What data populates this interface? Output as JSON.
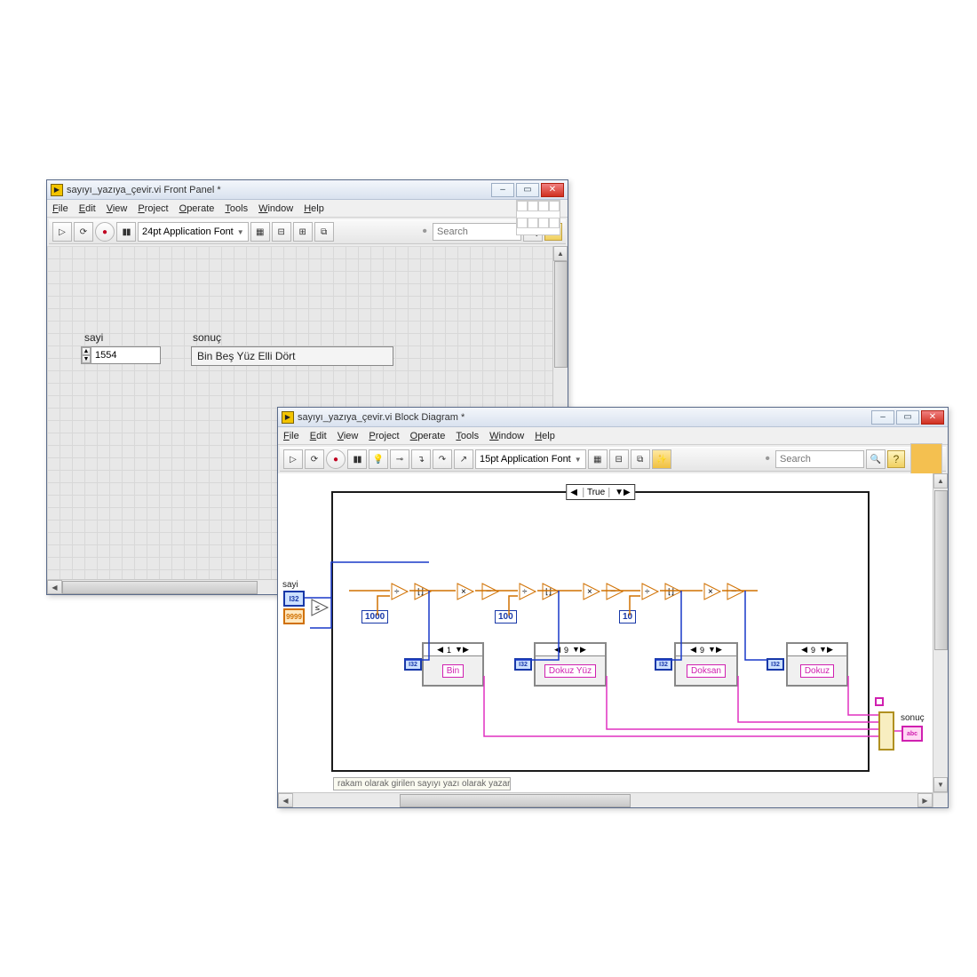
{
  "front_panel": {
    "title": "sayıyı_yazıya_çevir.vi Front Panel *",
    "menu": [
      "File",
      "Edit",
      "View",
      "Project",
      "Operate",
      "Tools",
      "Window",
      "Help"
    ],
    "font_selector": "24pt Application Font",
    "search_placeholder": "Search",
    "controls": {
      "sayi": {
        "label": "sayi",
        "value": "1554"
      },
      "sonuc": {
        "label": "sonuç",
        "value": "Bin Beş Yüz Elli Dört"
      }
    }
  },
  "block_diagram": {
    "title": "sayıyı_yazıya_çevir.vi Block Diagram *",
    "menu": [
      "File",
      "Edit",
      "View",
      "Project",
      "Operate",
      "Tools",
      "Window",
      "Help"
    ],
    "font_selector": "15pt Application Font",
    "search_placeholder": "Search",
    "case_selector": "True",
    "terminals": {
      "sayi": "sayi",
      "const9999": "9999",
      "sonuc": "sonuç"
    },
    "constants": {
      "c1000": "1000",
      "c100": "100",
      "c10": "10"
    },
    "case_boxes": [
      {
        "index": "1",
        "string": "Bin"
      },
      {
        "index": "9",
        "string": "Dokuz Yüz"
      },
      {
        "index": "9",
        "string": "Doksan"
      },
      {
        "index": "9",
        "string": "Dokuz"
      }
    ],
    "note": "rakam olarak girilen sayıyı yazı olarak yazar"
  }
}
